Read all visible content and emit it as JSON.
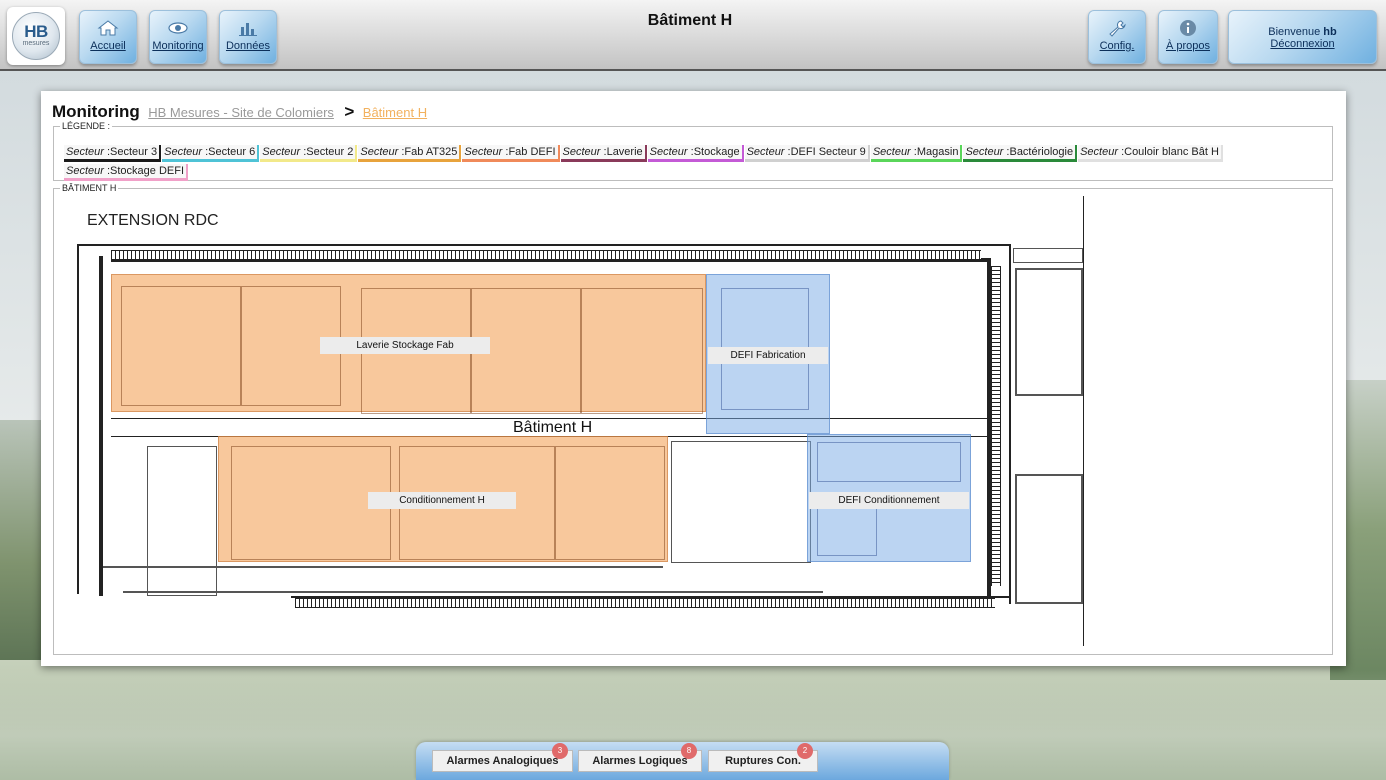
{
  "header": {
    "title": "Bâtiment H",
    "logo": {
      "text": "HB",
      "sub": "mesures"
    },
    "nav": [
      {
        "label": "Accueil",
        "icon": "home-icon"
      },
      {
        "label": "Monitoring",
        "icon": "eye-icon"
      },
      {
        "label": "Données",
        "icon": "chart-icon"
      }
    ],
    "config_label": "Config.",
    "about_label": "À propos",
    "welcome_prefix": "Bienvenue",
    "user": "hb",
    "logout_label": "Déconnexion"
  },
  "breadcrumb": {
    "title": "Monitoring",
    "site": "HB Mesures - Site de Colomiers",
    "separator": ">",
    "current": "Bâtiment H"
  },
  "legend": {
    "title": "LÉGENDE :",
    "items": [
      {
        "prefix": "Secteur",
        "name": ":Secteur 3",
        "color": "#1a1a1a"
      },
      {
        "prefix": "Secteur",
        "name": ":Secteur 6",
        "color": "#4fc3d6"
      },
      {
        "prefix": "Secteur",
        "name": ":Secteur 2",
        "color": "#f2e98a"
      },
      {
        "prefix": "Secteur",
        "name": ":Fab AT325",
        "color": "#e8a33c"
      },
      {
        "prefix": "Secteur",
        "name": ":Fab DEFI",
        "color": "#f08a5a"
      },
      {
        "prefix": "Secteur",
        "name": ":Laverie",
        "color": "#8a3a5a"
      },
      {
        "prefix": "Secteur",
        "name": ":Stockage",
        "color": "#c45ad6"
      },
      {
        "prefix": "Secteur",
        "name": ":DEFI Secteur 9",
        "color": "#d0d0d0"
      },
      {
        "prefix": "Secteur",
        "name": ":Magasin",
        "color": "#5ad65a"
      },
      {
        "prefix": "Secteur",
        "name": ":Bactériologie",
        "color": "#2a8a3a"
      },
      {
        "prefix": "Secteur",
        "name": ":Couloir blanc Bât H",
        "color": "#e0e0e0"
      },
      {
        "prefix": "Secteur",
        "name": ":Stockage DEFI",
        "color": "#f0a0c8"
      }
    ]
  },
  "plan": {
    "box_title": "BÂTIMENT H",
    "plan_title": "EXTENSION RDC",
    "building_label": "Bâtiment H",
    "zones": [
      {
        "label": "Laverie Stockage Fab"
      },
      {
        "label": "DEFI Fabrication"
      },
      {
        "label": "Conditionnement H"
      },
      {
        "label": "DEFI Conditionnement"
      }
    ]
  },
  "bottom_tabs": [
    {
      "label": "Alarmes Analogiques",
      "badge": "3"
    },
    {
      "label": "Alarmes Logiques",
      "badge": "8"
    },
    {
      "label": "Ruptures Con.",
      "badge": "2"
    }
  ]
}
